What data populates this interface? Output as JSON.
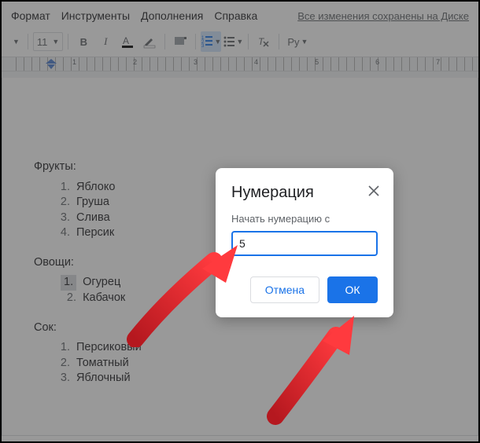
{
  "menu": {
    "format": "Формат",
    "tools": "Инструменты",
    "addons": "Дополнения",
    "help": "Справка",
    "save_status": "Все изменения сохранены на Диске"
  },
  "toolbar": {
    "font_size": "11",
    "spellcheck_label": "Ру"
  },
  "ruler": {
    "n1": "1",
    "n2": "2",
    "n3": "3",
    "n4": "4",
    "n5": "5",
    "n6": "6",
    "n7": "7"
  },
  "doc": {
    "s1": {
      "title": "Фрукты:",
      "items": [
        "Яблоко",
        "Груша",
        "Слива",
        "Персик"
      ]
    },
    "s2": {
      "title": "Овощи:",
      "items": [
        "Огурец",
        "Кабачок"
      ],
      "hl_num": "1."
    },
    "s3": {
      "title": "Сок:",
      "items": [
        "Персиковый",
        "Томатный",
        "Яблочный"
      ]
    }
  },
  "dialog": {
    "title": "Нумерация",
    "label": "Начать нумерацию с",
    "value": "5",
    "cancel": "Отмена",
    "ok": "ОК"
  }
}
